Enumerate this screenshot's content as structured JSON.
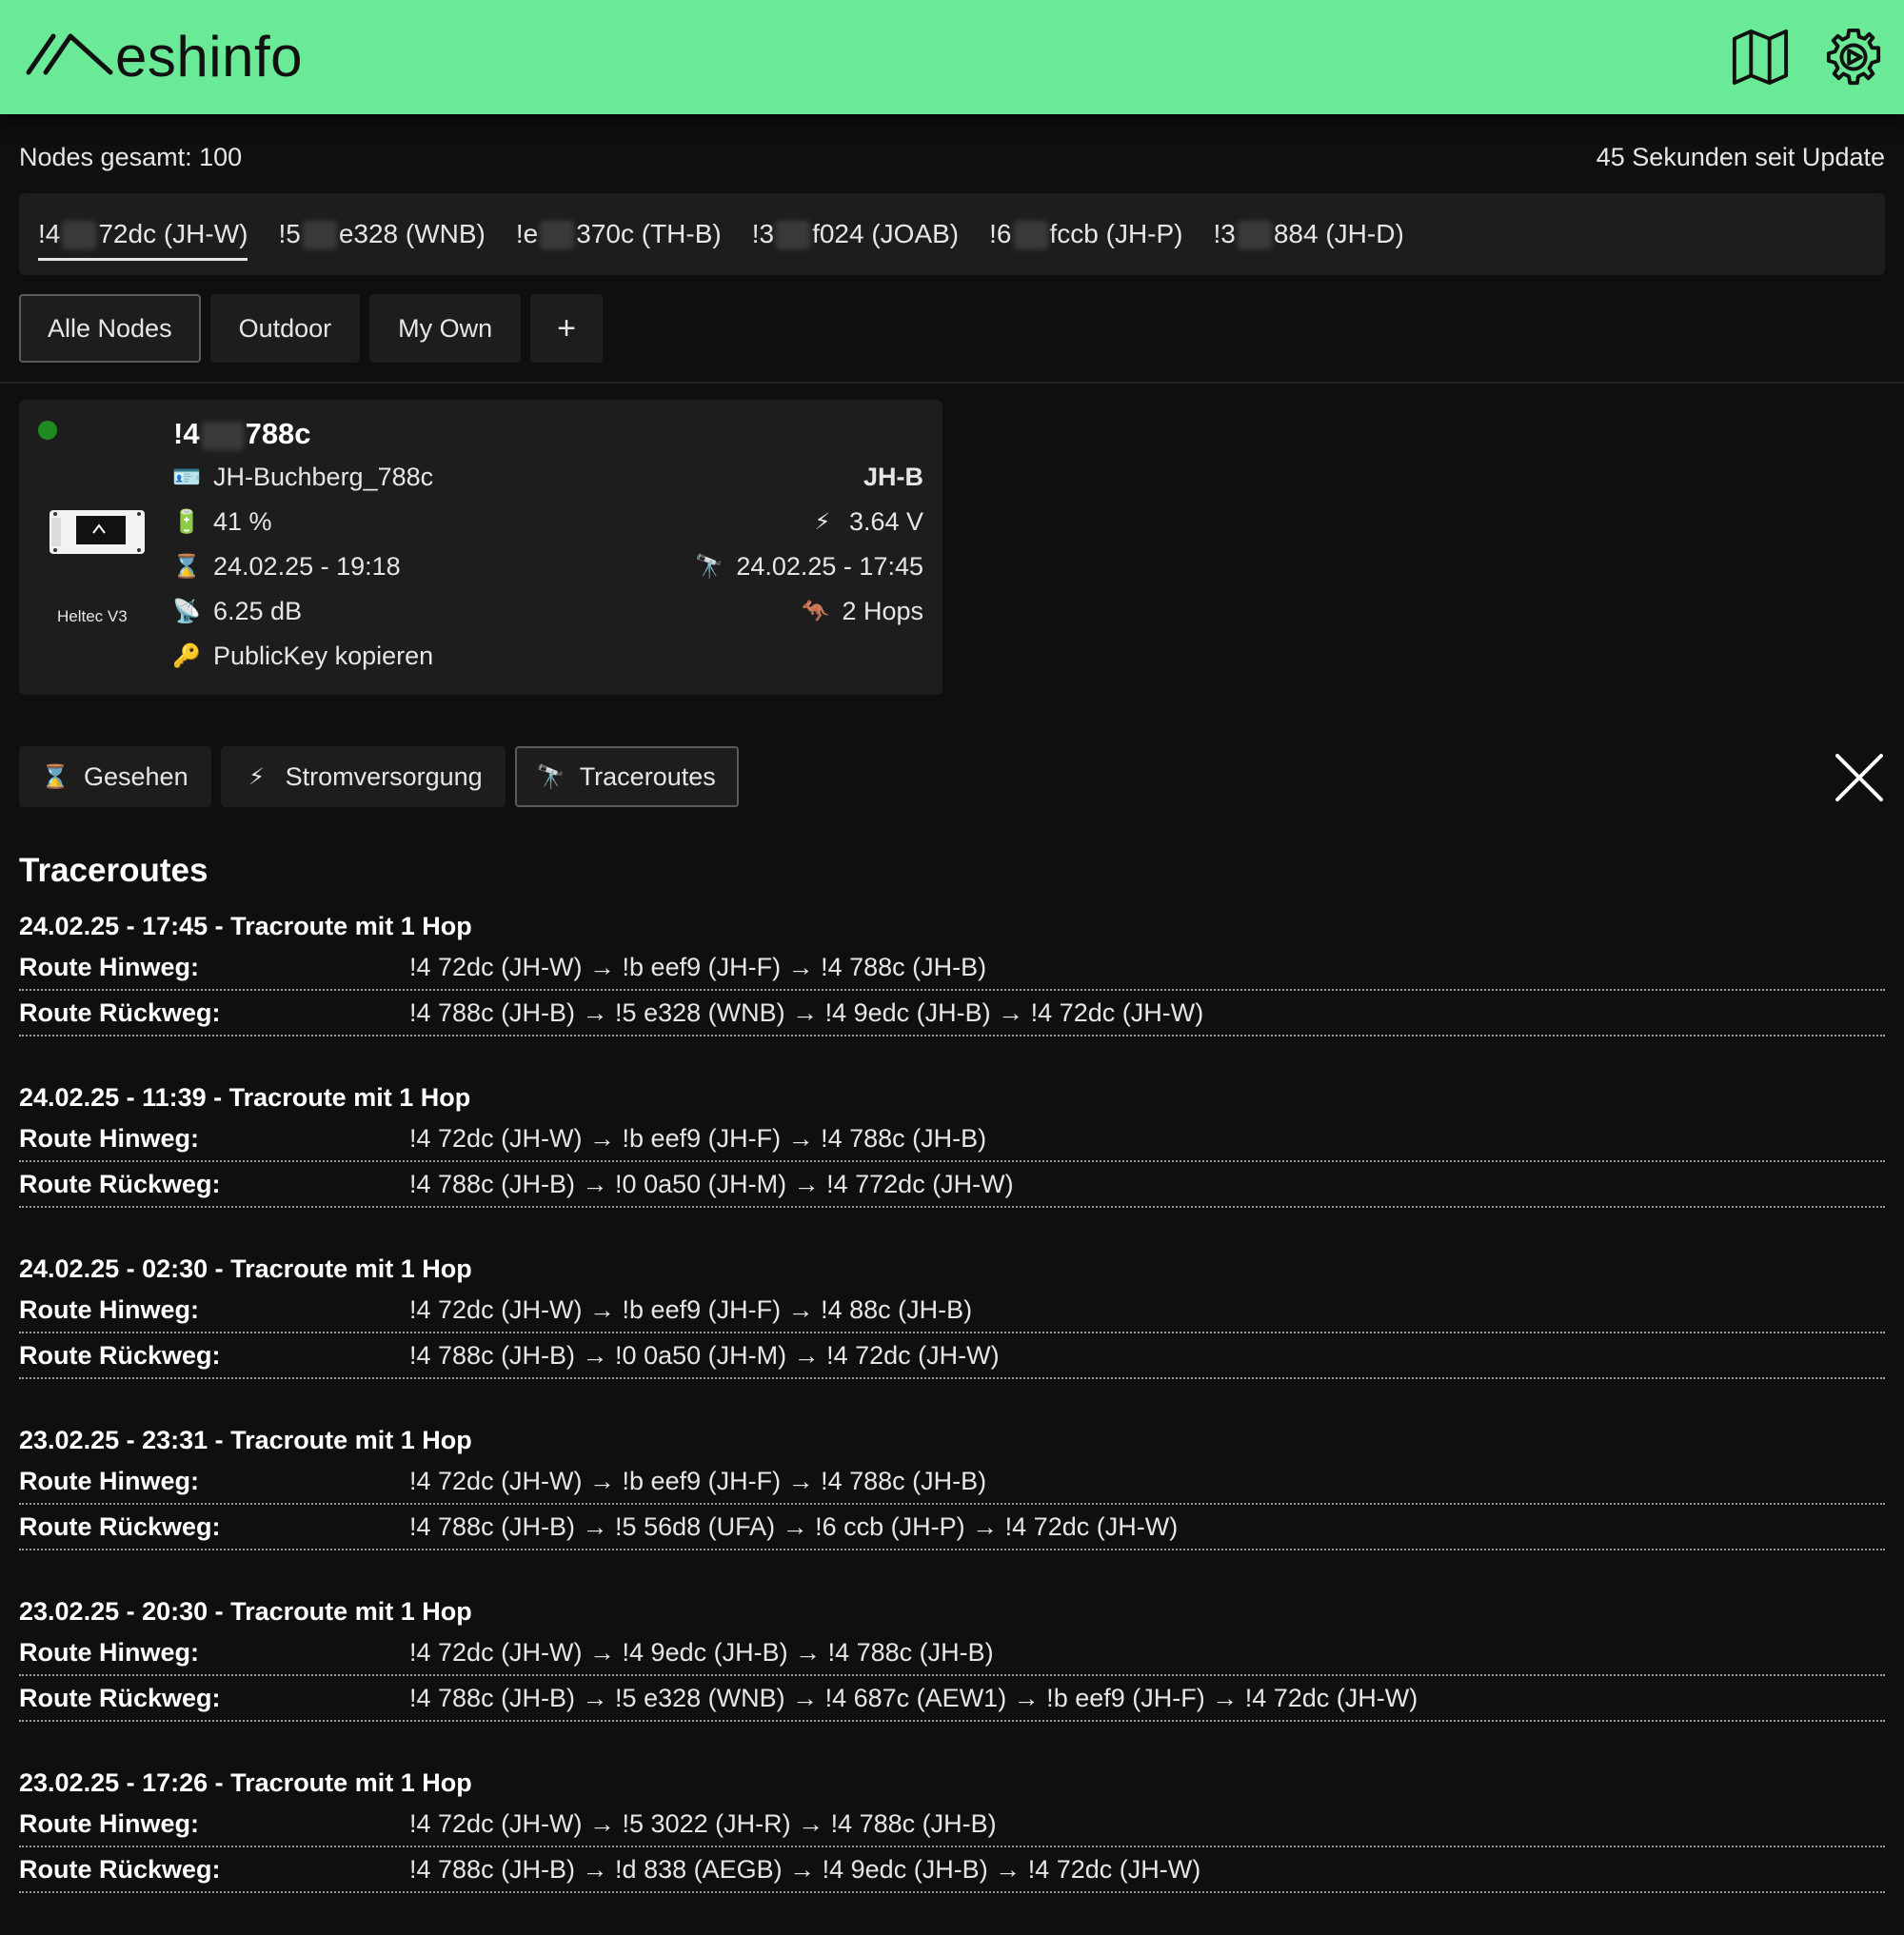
{
  "header": {
    "logo_text": "eshinfo",
    "icons": [
      "map-icon",
      "settings-icon"
    ]
  },
  "meta": {
    "nodes_total": "Nodes gesamt: 100",
    "update": "45 Sekunden seit Update"
  },
  "favorites": [
    {
      "prefix": "!4",
      "suffix": "72dc (JH-W)"
    },
    {
      "prefix": "!5",
      "suffix": "e328 (WNB)"
    },
    {
      "prefix": "!e",
      "suffix": "370c (TH-B)"
    },
    {
      "prefix": "!3",
      "suffix": "f024 (JOAB)"
    },
    {
      "prefix": "!6",
      "suffix": "fccb (JH-P)"
    },
    {
      "prefix": "!3",
      "suffix": "884 (JH-D)"
    }
  ],
  "filters": {
    "all": "Alle Nodes",
    "outdoor": "Outdoor",
    "own": "My Own",
    "add": "+"
  },
  "node": {
    "id_prefix": "!4",
    "id_suffix": "788c",
    "device": "Heltec V3",
    "long_name": "JH-Buchberg_788c",
    "short_name": "JH-B",
    "battery": "41 %",
    "voltage": "3.64 V",
    "last_seen": "24.02.25 - 19:18",
    "last_traceroute": "24.02.25 - 17:45",
    "snr": "6.25 dB",
    "hops": "2 Hops",
    "pubkey": "PublicKey kopieren"
  },
  "tabs": {
    "seen": "Gesehen",
    "power": "Stromversorgung",
    "traceroutes": "Traceroutes"
  },
  "traceroutes": {
    "title": "Traceroutes",
    "label_forward": "Route Hinweg:",
    "label_back": "Route Rückweg:",
    "entries": [
      {
        "head": "24.02.25 - 17:45 - Tracroute mit 1 Hop",
        "forward": "!4     72dc (JH-W) → !b     eef9 (JH-F) → !4     788c (JH-B)",
        "back": "!4     788c (JH-B) → !5     e328 (WNB) → !4     9edc (JH-B) → !4     72dc (JH-W)"
      },
      {
        "head": "24.02.25 - 11:39 - Tracroute mit 1 Hop",
        "forward": "!4     72dc (JH-W) → !b     eef9 (JH-F) → !4     788c (JH-B)",
        "back": "!4     788c (JH-B) → !0     0a50 (JH-M) → !4     772dc (JH-W)"
      },
      {
        "head": "24.02.25 - 02:30 - Tracroute mit 1 Hop",
        "forward": "!4     72dc (JH-W) → !b     eef9 (JH-F) → !4     88c (JH-B)",
        "back": "!4     788c (JH-B) → !0     0a50 (JH-M) → !4     72dc (JH-W)"
      },
      {
        "head": "23.02.25 - 23:31 - Tracroute mit 1 Hop",
        "forward": "!4     72dc (JH-W) → !b     eef9 (JH-F) → !4     788c (JH-B)",
        "back": "!4     788c (JH-B) → !5     56d8 (UFA) → !6     ccb (JH-P) → !4     72dc (JH-W)"
      },
      {
        "head": "23.02.25 - 20:30 - Tracroute mit 1 Hop",
        "forward": "!4     72dc (JH-W) → !4     9edc (JH-B) → !4     788c (JH-B)",
        "back": "!4     788c (JH-B) → !5     e328 (WNB) → !4     687c (AEW1) → !b     eef9 (JH-F) → !4     72dc (JH-W)"
      },
      {
        "head": "23.02.25 - 17:26 - Tracroute mit 1 Hop",
        "forward": "!4     72dc (JH-W) → !5     3022 (JH-R) → !4     788c (JH-B)",
        "back": "!4     788c (JH-B) → !d     838 (AEGB) → !4     9edc (JH-B) → !4     72dc (JH-W)"
      }
    ]
  },
  "colors": {
    "header_bg": "#6aea97",
    "page_bg": "#0f0f0f",
    "card_bg": "#1d1d1d",
    "online_dot": "#1f8a1f"
  }
}
